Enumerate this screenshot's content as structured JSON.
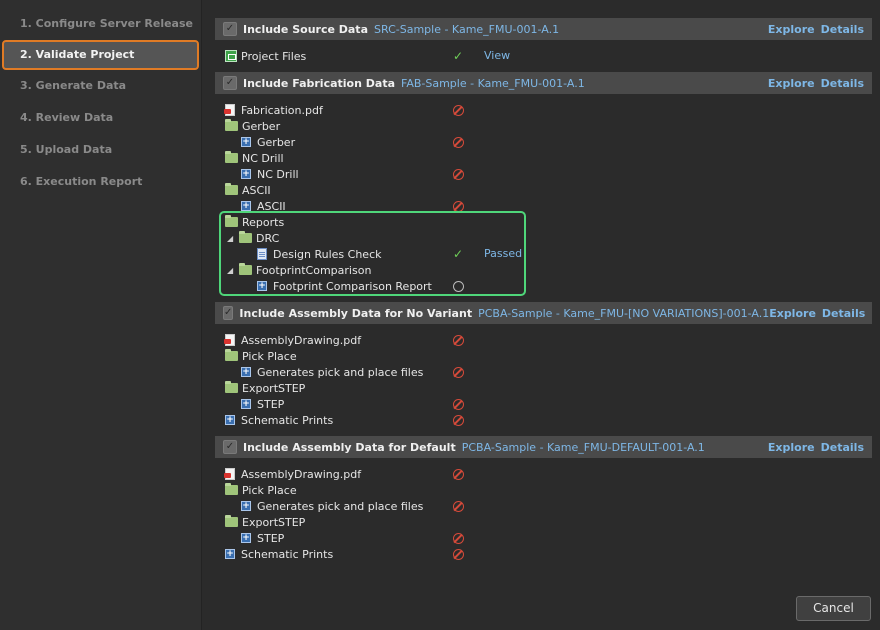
{
  "steps": [
    "1. Configure Server Release",
    "2. Validate Project",
    "3. Generate Data",
    "4. Review Data",
    "5. Upload Data",
    "6. Execution Report"
  ],
  "active_step": "2. Validate Project",
  "sections": [
    {
      "title": "Include Source Data",
      "subtitle": "SRC-Sample - Kame_FMU-001-A.1",
      "explore": "Explore",
      "details": "Details",
      "items": [
        {
          "label": "Project Files",
          "icon": "project-icon",
          "status": "check",
          "link": "View"
        }
      ]
    },
    {
      "title": "Include Fabrication Data",
      "subtitle": "FAB-Sample - Kame_FMU-001-A.1",
      "explore": "Explore",
      "details": "Details",
      "items": [
        {
          "label": "Fabrication.pdf",
          "icon": "pdf-icon",
          "status": "blocked"
        },
        {
          "label": "Gerber",
          "icon": "folder-icon"
        },
        {
          "label": "Gerber",
          "icon": "plus-icon",
          "status": "blocked"
        },
        {
          "label": "NC Drill",
          "icon": "folder-icon"
        },
        {
          "label": "NC Drill",
          "icon": "plus-icon",
          "status": "blocked"
        },
        {
          "label": "ASCII",
          "icon": "folder-icon"
        },
        {
          "label": "ASCII",
          "icon": "plus-icon",
          "status": "blocked"
        },
        {
          "label": "Reports",
          "icon": "folder-icon"
        },
        {
          "label": "DRC",
          "icon": "folder-icon"
        },
        {
          "label": "Design Rules Check",
          "icon": "document-icon",
          "status": "check",
          "link": "Passed"
        },
        {
          "label": "FootprintComparison",
          "icon": "folder-icon"
        },
        {
          "label": "Footprint Comparison Report",
          "icon": "plus-icon",
          "status": "pending"
        }
      ]
    },
    {
      "title": "Include Assembly Data for No Variant",
      "subtitle": "PCBA-Sample - Kame_FMU-[NO VARIATIONS]-001-A.1",
      "explore": "Explore",
      "details": "Details",
      "items": [
        {
          "label": "AssemblyDrawing.pdf",
          "icon": "pdf-icon",
          "status": "blocked"
        },
        {
          "label": "Pick Place",
          "icon": "folder-icon"
        },
        {
          "label": "Generates pick and place files",
          "icon": "plus-icon",
          "status": "blocked"
        },
        {
          "label": "ExportSTEP",
          "icon": "folder-icon"
        },
        {
          "label": "STEP",
          "icon": "plus-icon",
          "status": "blocked"
        },
        {
          "label": "Schematic Prints",
          "icon": "plus-icon",
          "status": "blocked"
        }
      ]
    },
    {
      "title": "Include Assembly Data for Default",
      "subtitle": "PCBA-Sample - Kame_FMU-DEFAULT-001-A.1",
      "explore": "Explore",
      "details": "Details",
      "items": [
        {
          "label": "AssemblyDrawing.pdf",
          "icon": "pdf-icon",
          "status": "blocked"
        },
        {
          "label": "Pick Place",
          "icon": "folder-icon"
        },
        {
          "label": "Generates pick and place files",
          "icon": "plus-icon",
          "status": "blocked"
        },
        {
          "label": "ExportSTEP",
          "icon": "folder-icon"
        },
        {
          "label": "STEP",
          "icon": "plus-icon",
          "status": "blocked"
        },
        {
          "label": "Schematic Prints",
          "icon": "plus-icon",
          "status": "blocked"
        }
      ]
    }
  ],
  "cancel_label": "Cancel",
  "colors": {
    "accent_orange": "#e07b25",
    "link_blue": "#7eb7e6",
    "highlight_green": "#4fd67a",
    "error_red": "#d64a3a",
    "ok_green": "#6fcf58"
  }
}
